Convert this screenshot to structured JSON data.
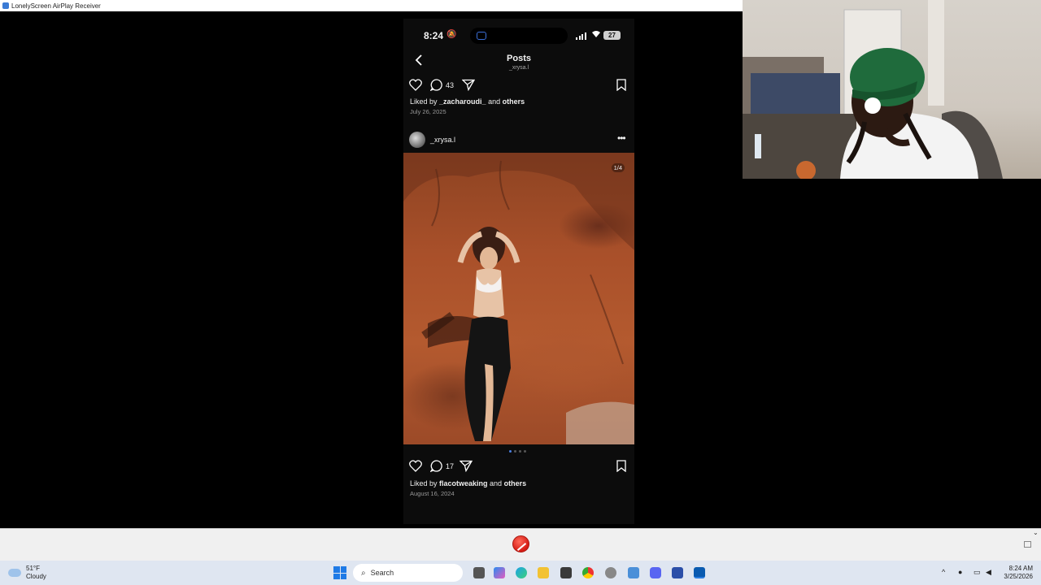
{
  "window": {
    "title": "LonelyScreen AirPlay Receiver"
  },
  "phone": {
    "status": {
      "time": "8:24",
      "battery": "27"
    },
    "nav": {
      "title": "Posts",
      "subtitle": "_xrysa.l"
    },
    "prev_post": {
      "comments": "43",
      "liked_by_prefix": "Liked by ",
      "liked_by_user": "_zacharoudi_",
      "liked_and": " and ",
      "liked_others": "others",
      "date": "July 26, 2025"
    },
    "post": {
      "username": "_xrysa.l",
      "counter": "1/4",
      "comments": "17",
      "liked_by_prefix": "Liked by ",
      "liked_by_user": "flacotweaking",
      "liked_and": " and ",
      "liked_others": "others",
      "date": "August 16, 2024"
    }
  },
  "taskbar": {
    "weather_temp": "51°F",
    "weather_desc": "Cloudy",
    "search_label": "Search",
    "time": "8:24 AM",
    "date": "3/25/2026"
  }
}
